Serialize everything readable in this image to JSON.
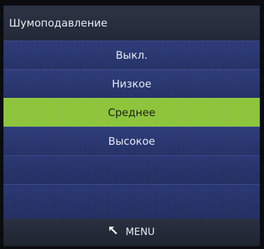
{
  "header": {
    "title": "Шумоподавление"
  },
  "options": [
    {
      "label": "Выкл.",
      "selected": false
    },
    {
      "label": "Низкое",
      "selected": false
    },
    {
      "label": "Среднее",
      "selected": true
    },
    {
      "label": "Высокое",
      "selected": false
    }
  ],
  "footer": {
    "menu_label": "MENU",
    "icon": "back-arrow-icon"
  },
  "colors": {
    "selected": "#8cc43a",
    "row": "#2c3a78",
    "header": "#2c3344"
  }
}
